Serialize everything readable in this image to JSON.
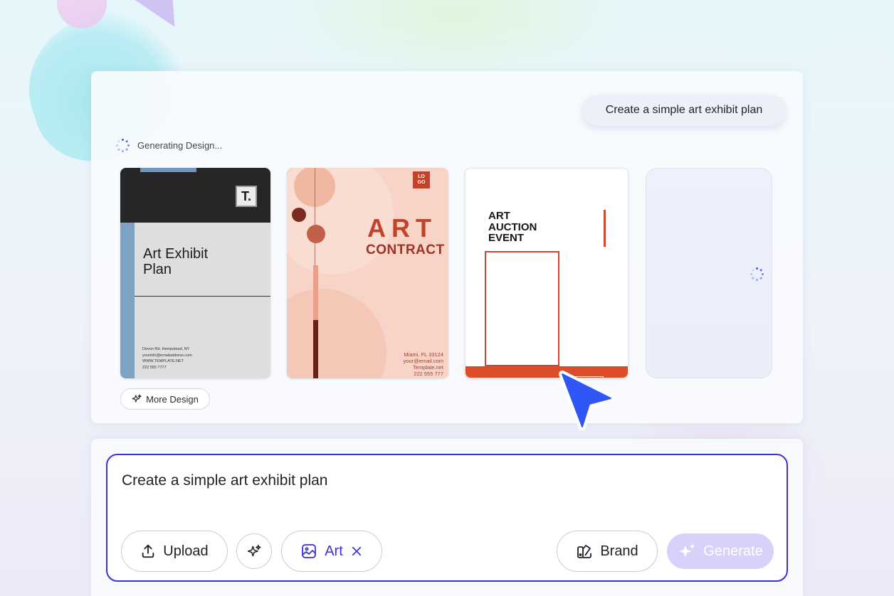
{
  "chat": {
    "prompt_bubble": "Create a simple art exhibit plan",
    "status": "Generating Design..."
  },
  "designs": [
    {
      "title_line1": "Art Exhibit",
      "title_line2": "Plan",
      "logo": "T.",
      "address_lines": [
        "Devon Rd, Hempstead, NY",
        "yourinfo@emailaddress.com",
        "WWW.TEMPLATE.NET",
        "222 555 7777"
      ]
    },
    {
      "logo_line1": "LO",
      "logo_line2": "GO",
      "title": "ART",
      "subtitle": "CONTRACT",
      "address_lines": [
        "Miami, FL 33124",
        "your@email.com",
        "Template.net",
        "222 555 777"
      ]
    },
    {
      "title_lines": [
        "ART",
        "AUCTION",
        "EVENT"
      ]
    }
  ],
  "more_design_label": "More Design",
  "composer": {
    "input_value": "Create a simple art exhibit plan",
    "upload_label": "Upload",
    "art_label": "Art",
    "brand_label": "Brand",
    "generate_label": "Generate"
  },
  "colors": {
    "accent": "#3b2fd6",
    "generate_bg": "#d8d2fb",
    "cursor": "#2f57f5"
  },
  "icons": [
    "upload-icon",
    "sparkles-icon",
    "art-image-icon",
    "close-icon",
    "brand-palette-icon",
    "cursor-pointer-icon",
    "loading-spinner-icon"
  ]
}
